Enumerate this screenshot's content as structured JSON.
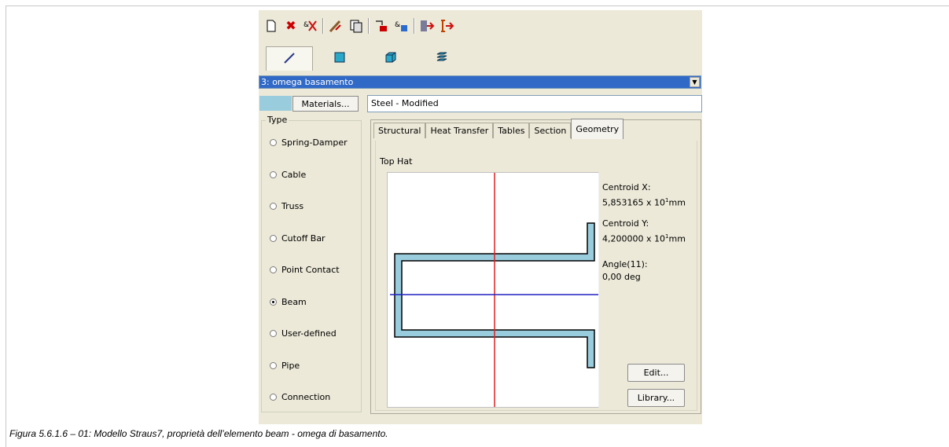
{
  "window": {
    "toolbar_icons": [
      "new-document-icon",
      "delete-icon",
      "properties-icon",
      "edit-icon",
      "copy-icon",
      "assign-icon",
      "apply-icon",
      "import-icon",
      "export-icon"
    ],
    "element_types": [
      "line-beam-icon",
      "plate-icon",
      "brick-icon",
      "ply-icon"
    ],
    "property": {
      "selected": "3: omega basamento"
    },
    "material": {
      "button_label": "Materials...",
      "name": "Steel - Modified",
      "swatch_color": "#99ccdd"
    },
    "type_group": {
      "label": "Type",
      "options": [
        {
          "label": "Spring-Damper",
          "selected": false
        },
        {
          "label": "Cable",
          "selected": false
        },
        {
          "label": "Truss",
          "selected": false
        },
        {
          "label": "Cutoff Bar",
          "selected": false
        },
        {
          "label": "Point Contact",
          "selected": false
        },
        {
          "label": "Beam",
          "selected": true
        },
        {
          "label": "User-defined",
          "selected": false
        },
        {
          "label": "Pipe",
          "selected": false
        },
        {
          "label": "Connection",
          "selected": false
        }
      ]
    },
    "tabs": [
      "Structural",
      "Heat Transfer",
      "Tables",
      "Section",
      "Geometry"
    ],
    "active_tab": "Geometry",
    "geometry": {
      "section_name": "Top Hat",
      "centroid_x_label": "Centroid X:",
      "centroid_x_value": "5,853165",
      "centroid_y_label": "Centroid Y:",
      "centroid_y_value": "4,200000",
      "exp_text": "x 10",
      "exp": "1",
      "unit": "mm",
      "angle_label": "Angle(11):",
      "angle_value": "0,00 deg",
      "section_fill": "#99ccdd",
      "axis_vertical_color": "#e02020",
      "axis_horizontal_color": "#2020c0"
    },
    "buttons": {
      "edit": "Edit...",
      "library": "Library..."
    }
  },
  "caption": "Figura 5.6.1.6 – 01: Modello Straus7, proprietà dell’elemento beam - omega di basamento."
}
